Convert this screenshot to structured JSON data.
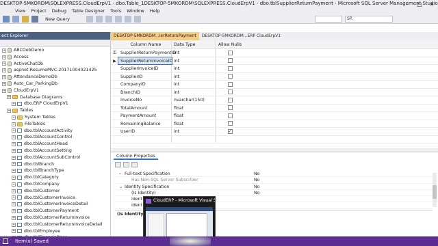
{
  "window": {
    "title": "DESKTOP-5MKORDM\\SQLEXPRESS.CloudErpV1 - dbo.Table_1DESKTOP-5MKORDM\\SQLEXPRESS.CloudErpV1 - dbo.tblSupplierReturnPayment - Microsoft SQL Server Management Studio"
  },
  "menu": [
    "View",
    "Project",
    "Debug",
    "Table Designer",
    "Tools",
    "Window",
    "Help"
  ],
  "toolbar": {
    "new_query": "New Query",
    "database_dropdown": "SP."
  },
  "object_explorer": {
    "header": "ect Explorer",
    "items": [
      {
        "label": "ABCDebDemo",
        "icon": "database-icon",
        "indent": 1
      },
      {
        "label": "Access",
        "icon": "database-icon",
        "indent": 1
      },
      {
        "label": "ActiveChatDb",
        "icon": "database-icon",
        "indent": 1
      },
      {
        "label": "aspnet-ResumeMVC-20171004021425",
        "icon": "database-icon",
        "indent": 1
      },
      {
        "label": "AttendanceDemoDb",
        "icon": "database-icon",
        "indent": 1
      },
      {
        "label": "Auto_Car_ParkingDb",
        "icon": "database-icon",
        "indent": 1
      },
      {
        "label": "CloudErpV1",
        "icon": "database-icon",
        "indent": 1
      },
      {
        "label": "Database Diagrams",
        "icon": "folder-icon",
        "indent": 2
      },
      {
        "label": "dbo.ERP CloudErpV1",
        "icon": "diagram-icon",
        "indent": 3
      },
      {
        "label": "Tables",
        "icon": "folder-icon",
        "indent": 2
      },
      {
        "label": "System Tables",
        "icon": "folder-icon",
        "indent": 3
      },
      {
        "label": "FileTables",
        "icon": "folder-icon",
        "indent": 3
      },
      {
        "label": "dbo.tblAccountActivity",
        "icon": "table-icon",
        "indent": 3
      },
      {
        "label": "dbo.tblAccountControl",
        "icon": "table-icon",
        "indent": 3
      },
      {
        "label": "dbo.tblAccountHead",
        "icon": "table-icon",
        "indent": 3
      },
      {
        "label": "dbo.tblAccountSetting",
        "icon": "table-icon",
        "indent": 3
      },
      {
        "label": "dbo.tblAccountSubControl",
        "icon": "table-icon",
        "indent": 3
      },
      {
        "label": "dbo.tblBranch",
        "icon": "table-icon",
        "indent": 3
      },
      {
        "label": "dbo.tblBranchType",
        "icon": "table-icon",
        "indent": 3
      },
      {
        "label": "dbo.tblCategory",
        "icon": "table-icon",
        "indent": 3
      },
      {
        "label": "dbo.tblCompany",
        "icon": "table-icon",
        "indent": 3
      },
      {
        "label": "dbo.tblCustomer",
        "icon": "table-icon",
        "indent": 3
      },
      {
        "label": "dbo.tblCustomerInvoice",
        "icon": "table-icon",
        "indent": 3
      },
      {
        "label": "dbo.tblCustomerInvoiceDetail",
        "icon": "table-icon",
        "indent": 3
      },
      {
        "label": "dbo.tblCustomerPayment",
        "icon": "table-icon",
        "indent": 3
      },
      {
        "label": "dbo.tblCustomerReturnInvoice",
        "icon": "table-icon",
        "indent": 3
      },
      {
        "label": "dbo.tblCustomerReturnInvoiceDetail",
        "icon": "table-icon",
        "indent": 3
      },
      {
        "label": "dbo.tblEmployee",
        "icon": "table-icon",
        "indent": 3
      },
      {
        "label": "dbo.tblFinancialYear",
        "icon": "table-icon",
        "indent": 3
      }
    ]
  },
  "tabs": [
    {
      "label": "DESKTOP-5MKORDM...ierReturnPayment",
      "active": true
    },
    {
      "label": "DESKTOP-5MKORDM...ERP CloudErpV1",
      "active": false
    }
  ],
  "designer": {
    "headers": {
      "column_name": "Column Name",
      "data_type": "Data Type",
      "allow_nulls": "Allow Nulls"
    },
    "rows": [
      {
        "name": "SupplierReturnPaymentID",
        "type": "int",
        "nulls": false,
        "key": true,
        "selected": false
      },
      {
        "name": "SupplierReturnInvoiceID",
        "type": "int",
        "nulls": false,
        "key": false,
        "selected": true
      },
      {
        "name": "SupplierInvoiceID",
        "type": "int",
        "nulls": false,
        "key": false,
        "selected": false
      },
      {
        "name": "SupplierID",
        "type": "int",
        "nulls": false,
        "key": false,
        "selected": false
      },
      {
        "name": "CompanyID",
        "type": "int",
        "nulls": false,
        "key": false,
        "selected": false
      },
      {
        "name": "BranchID",
        "type": "int",
        "nulls": false,
        "key": false,
        "selected": false
      },
      {
        "name": "InvoiceNo",
        "type": "nvarchar(150)",
        "nulls": false,
        "key": false,
        "selected": false
      },
      {
        "name": "TotalAmount",
        "type": "float",
        "nulls": false,
        "key": false,
        "selected": false
      },
      {
        "name": "PaymentAmount",
        "type": "float",
        "nulls": false,
        "key": false,
        "selected": false
      },
      {
        "name": "RemainingBalance",
        "type": "float",
        "nulls": false,
        "key": false,
        "selected": false
      },
      {
        "name": "UserID",
        "type": "int",
        "nulls": true,
        "key": false,
        "selected": false
      },
      {
        "name": "",
        "type": "",
        "nulls": false,
        "key": false,
        "selected": false
      }
    ]
  },
  "column_properties": {
    "tab_label": "Column Properties",
    "rows": [
      {
        "key": "Full-text Specification",
        "value": "No",
        "expander": "+"
      },
      {
        "key": "Has Non-SQL Server Subscriber",
        "value": "No",
        "expander": ""
      },
      {
        "key": "Identity Specification",
        "value": "No",
        "expander": "-"
      },
      {
        "key": "(Is Identity)",
        "value": "No",
        "expander": ""
      },
      {
        "key": "Ident",
        "value": "",
        "expander": ""
      },
      {
        "key": "Ident",
        "value": "",
        "expander": ""
      }
    ],
    "description": "(Is Identity)"
  },
  "taskbar_popup": {
    "title": "CloudERP - Microsoft Visual St..."
  },
  "status": {
    "text": "Item(s) Saved"
  },
  "colors": {
    "status_bar": "#5c2d91",
    "active_tab": "#f5cc84",
    "explorer_header": "#4d6082"
  }
}
